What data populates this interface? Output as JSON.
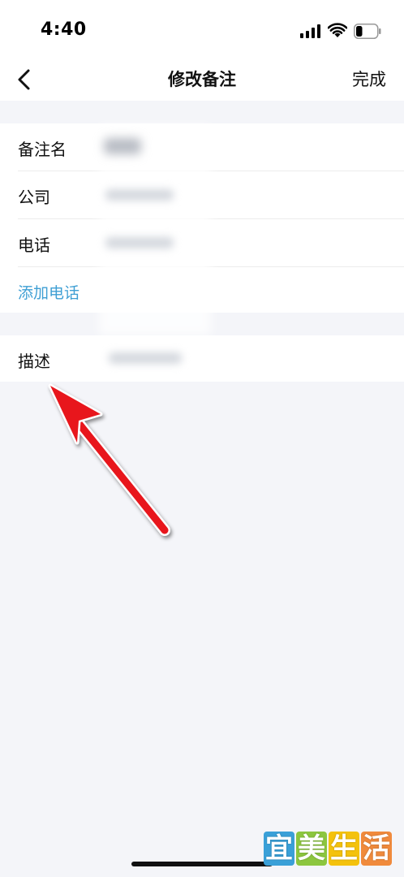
{
  "status_bar": {
    "time": "4:40",
    "signal_icon": "cellular-signal-icon",
    "wifi_icon": "wifi-icon",
    "battery_icon": "battery-icon",
    "battery_level": 0.3
  },
  "nav": {
    "back_icon": "chevron-left-icon",
    "title": "修改备注",
    "done_label": "完成"
  },
  "form": {
    "rows": [
      {
        "label": "备注名",
        "value": ""
      },
      {
        "label": "公司",
        "value": ""
      },
      {
        "label": "电话",
        "value": ""
      }
    ],
    "add_phone_label": "添加电话",
    "description_label": "描述",
    "description_value": ""
  },
  "watermark": {
    "chars": [
      "宜",
      "美",
      "生",
      "活"
    ],
    "colors": [
      "#3aa0d8",
      "#8cc63f",
      "#f4c20d",
      "#f08a3c"
    ]
  },
  "colors": {
    "background": "#f4f5f9",
    "link": "#3f9fd4",
    "arrow": "#e8141a"
  }
}
